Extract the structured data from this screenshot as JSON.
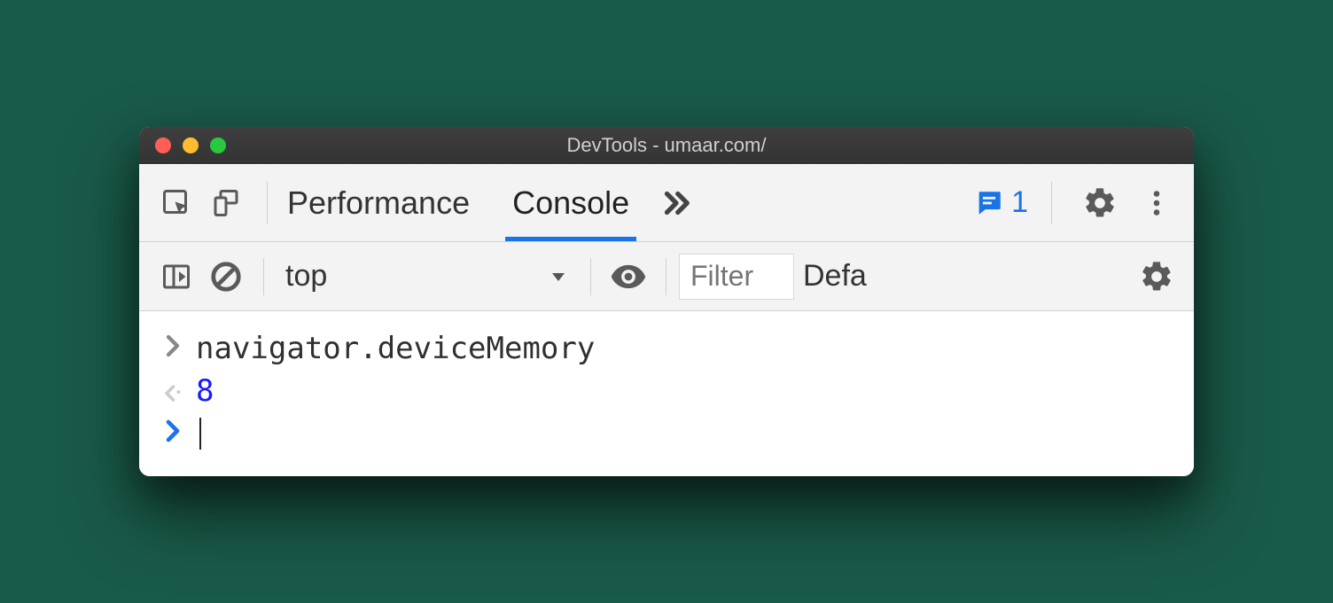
{
  "window": {
    "title": "DevTools - umaar.com/"
  },
  "mainToolbar": {
    "tabs": [
      {
        "label": "Performance",
        "active": false
      },
      {
        "label": "Console",
        "active": true
      }
    ],
    "messagesCount": "1"
  },
  "secondaryToolbar": {
    "context": "top",
    "filterPlaceholder": "Filter",
    "levelLabel": "Defa"
  },
  "console": {
    "input": "navigator.deviceMemory",
    "result": "8"
  }
}
